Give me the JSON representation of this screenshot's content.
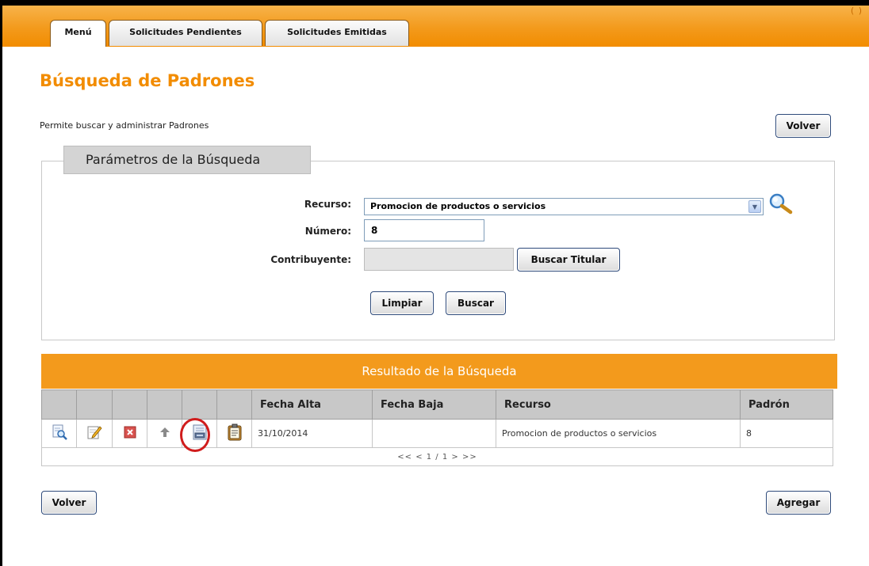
{
  "topbar": {
    "header_text": "(       )"
  },
  "tabs": [
    {
      "label": "Menú",
      "active": true
    },
    {
      "label": "Solicitudes Pendientes",
      "active": false
    },
    {
      "label": "Solicitudes Emitidas",
      "active": false
    }
  ],
  "page": {
    "title": "Búsqueda de Padrones",
    "description": "Permite buscar y administrar Padrones",
    "back_label": "Volver"
  },
  "search": {
    "legend": "Parámetros de la Búsqueda",
    "resource_label": "Recurso:",
    "resource_value": "Promocion de productos o servicios",
    "number_label": "Número:",
    "number_value": "8",
    "taxpayer_label": "Contribuyente:",
    "taxpayer_value": "",
    "find_holder_label": "Buscar Titular",
    "clear_label": "Limpiar",
    "search_label": "Buscar"
  },
  "results": {
    "title": "Resultado de la Búsqueda",
    "columns": [
      "Fecha Alta",
      "Fecha Baja",
      "Recurso",
      "Padrón"
    ],
    "rows": [
      {
        "fecha_alta": "31/10/2014",
        "fecha_baja": "",
        "recurso": "Promocion de productos o servicios",
        "padron": "8"
      }
    ],
    "pager": "<< < 1 / 1 > >>",
    "row_actions": [
      "view-icon",
      "edit-icon",
      "delete-icon",
      "up-arrow-icon",
      "print-icon",
      "clipboard-icon"
    ]
  },
  "footer": {
    "back_label": "Volver",
    "add_label": "Agregar"
  },
  "colors": {
    "accent": "#f28c00",
    "results_header": "#f39a1c",
    "highlight": "#d01c1c"
  }
}
